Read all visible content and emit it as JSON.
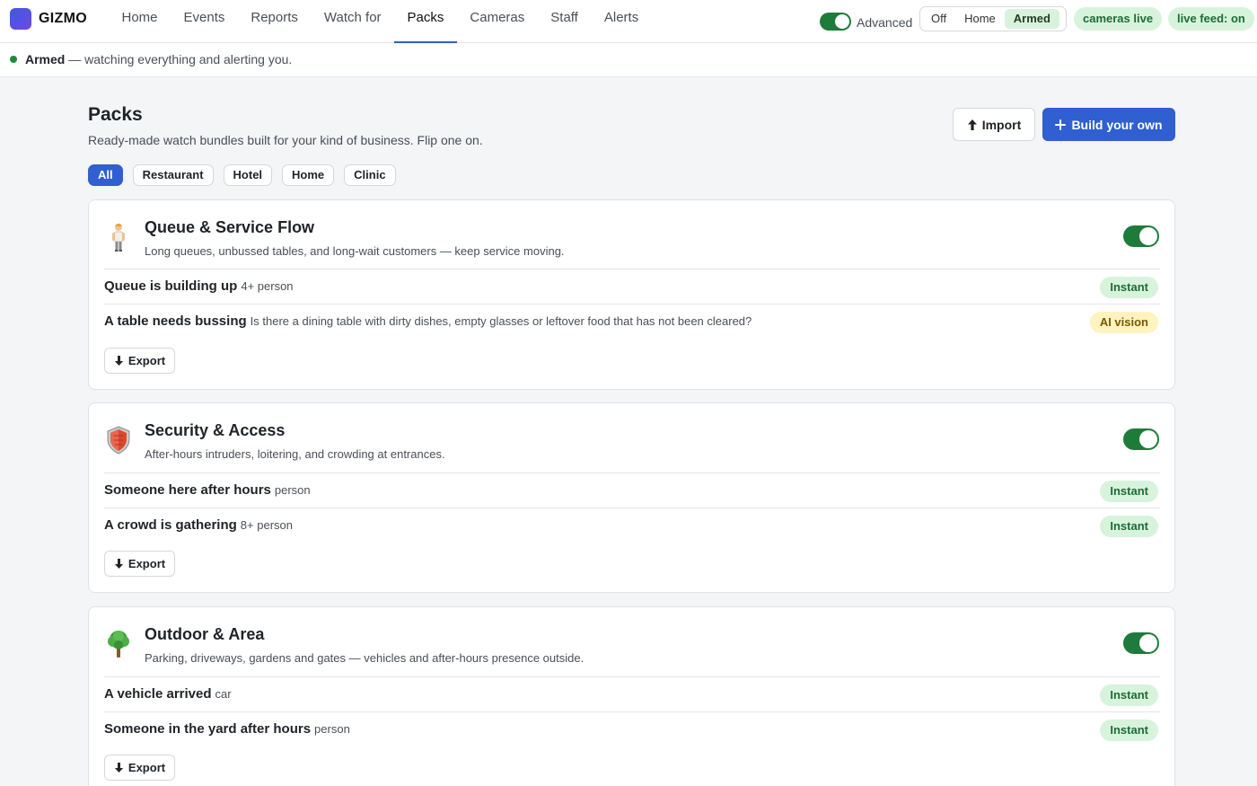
{
  "app": {
    "brand": "GIZMO"
  },
  "nav": {
    "tabs": [
      {
        "label": "Home"
      },
      {
        "label": "Events"
      },
      {
        "label": "Reports"
      },
      {
        "label": "Watch for"
      },
      {
        "label": "Packs"
      },
      {
        "label": "Cameras"
      },
      {
        "label": "Staff"
      },
      {
        "label": "Alerts"
      }
    ],
    "active": "Packs"
  },
  "topbar": {
    "advanced_label": "Advanced",
    "advanced_on": true,
    "modes": [
      "Off",
      "Home",
      "Armed"
    ],
    "active_mode": "Armed",
    "cameras_pill": "cameras live",
    "feed_pill": "live feed: on"
  },
  "status": {
    "state": "Armed",
    "message": "— watching everything and alerting you."
  },
  "header": {
    "title": "Packs",
    "subtitle": "Ready-made watch bundles built for your kind of business. Flip one on.",
    "import_label": "Import",
    "build_label": "Build your own"
  },
  "filters": [
    "All",
    "Restaurant",
    "Hotel",
    "Home",
    "Clinic"
  ],
  "active_filter": "All",
  "export_label": "Export",
  "packs": [
    {
      "icon": "person-standing-icon",
      "title": "Queue & Service Flow",
      "description": "Long queues, unbussed tables, and long-wait customers — keep service moving.",
      "enabled": true,
      "rules": [
        {
          "name": "Queue is building up",
          "detail": "4+ person",
          "badge": "Instant"
        },
        {
          "name": "A table needs bussing",
          "detail": "Is there a dining table with dirty dishes, empty glasses or leftover food that has not been cleared?",
          "badge": "AI vision"
        }
      ]
    },
    {
      "icon": "shield-icon",
      "title": "Security & Access",
      "description": "After-hours intruders, loitering, and crowding at entrances.",
      "enabled": true,
      "rules": [
        {
          "name": "Someone here after hours",
          "detail": "person",
          "badge": "Instant"
        },
        {
          "name": "A crowd is gathering",
          "detail": "8+ person",
          "badge": "Instant"
        }
      ]
    },
    {
      "icon": "tree-icon",
      "title": "Outdoor & Area",
      "description": "Parking, driveways, gardens and gates — vehicles and after-hours presence outside.",
      "enabled": true,
      "rules": [
        {
          "name": "A vehicle arrived",
          "detail": "car",
          "badge": "Instant"
        },
        {
          "name": "Someone in the yard after hours",
          "detail": "person",
          "badge": "Instant"
        }
      ]
    }
  ],
  "colors": {
    "accent": "#2f5fd0",
    "toggle_on": "#1e7b3a",
    "instant_bg": "#d8f3dc",
    "ai_bg": "#fff3bf"
  }
}
